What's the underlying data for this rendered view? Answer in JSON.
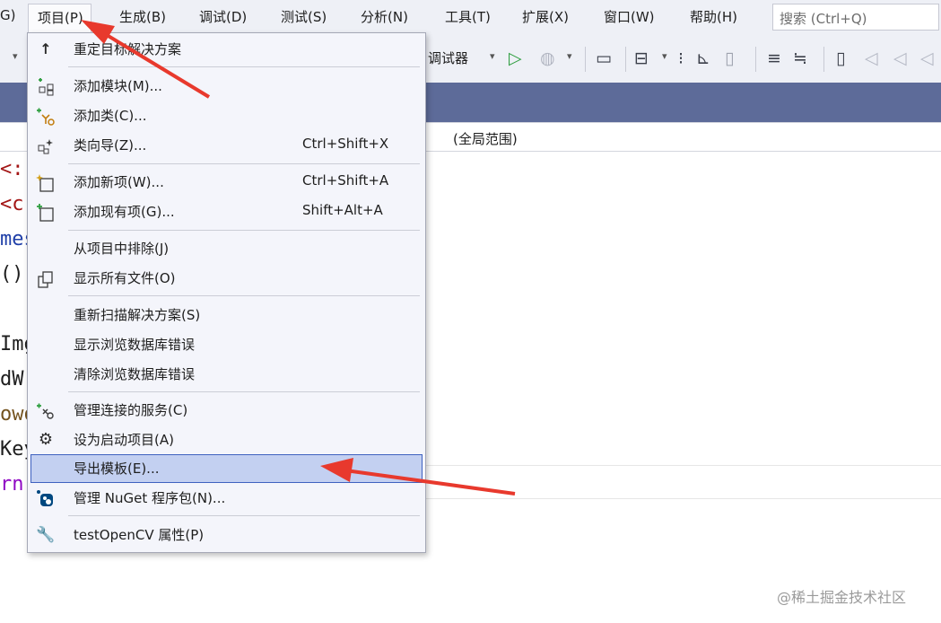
{
  "menubar": {
    "items": [
      {
        "label": "G)"
      },
      {
        "label": "项目(P)"
      },
      {
        "label": "生成(B)"
      },
      {
        "label": "调试(D)"
      },
      {
        "label": "测试(S)"
      },
      {
        "label": "分析(N)"
      },
      {
        "label": "工具(T)"
      },
      {
        "label": "扩展(X)"
      },
      {
        "label": "窗口(W)"
      },
      {
        "label": "帮助(H)"
      }
    ],
    "search_placeholder": "搜索 (Ctrl+Q)"
  },
  "toolbar": {
    "debugger_label": "调试器"
  },
  "scope_label": "(全局范围)",
  "code_fragments": [
    "<:",
    "<c",
    "mes",
    "()",
    "Img",
    "dW:",
    "owo",
    "Key",
    "rn"
  ],
  "project_menu": {
    "items": [
      {
        "icon": "up-arrow-icon",
        "label": "重定目标解决方案",
        "shortcut": ""
      },
      {
        "icon": "add-module-icon",
        "label": "添加模块(M)...",
        "shortcut": ""
      },
      {
        "icon": "add-class-icon",
        "label": "添加类(C)...",
        "shortcut": ""
      },
      {
        "icon": "class-wizard-icon",
        "label": "类向导(Z)...",
        "shortcut": "Ctrl+Shift+X"
      },
      {
        "icon": "add-new-item-icon",
        "label": "添加新项(W)...",
        "shortcut": "Ctrl+Shift+A"
      },
      {
        "icon": "add-existing-item-icon",
        "label": "添加现有项(G)...",
        "shortcut": "Shift+Alt+A"
      },
      {
        "icon": "",
        "label": "从项目中排除(J)",
        "shortcut": ""
      },
      {
        "icon": "show-all-files-icon",
        "label": "显示所有文件(O)",
        "shortcut": ""
      },
      {
        "icon": "",
        "label": "重新扫描解决方案(S)",
        "shortcut": ""
      },
      {
        "icon": "",
        "label": "显示浏览数据库错误",
        "shortcut": ""
      },
      {
        "icon": "",
        "label": "清除浏览数据库错误",
        "shortcut": ""
      },
      {
        "icon": "connected-services-icon",
        "label": "管理连接的服务(C)",
        "shortcut": ""
      },
      {
        "icon": "gear-icon",
        "label": "设为启动项目(A)",
        "shortcut": ""
      },
      {
        "icon": "",
        "label": "导出模板(E)...",
        "shortcut": ""
      },
      {
        "icon": "nuget-icon",
        "label": "管理 NuGet 程序包(N)...",
        "shortcut": ""
      },
      {
        "icon": "wrench-icon",
        "label": "testOpenCV 属性(P)",
        "shortcut": ""
      }
    ],
    "highlighted_item": "导出模板(E)..."
  },
  "watermark": "@稀土掘金技术社区",
  "colors": {
    "menubar_bg": "#eef0f6",
    "tab_strip": "#5d6b99",
    "highlight_bg": "#c3d0f1",
    "highlight_border": "#3f62c0",
    "arrow": "#e8392d"
  }
}
